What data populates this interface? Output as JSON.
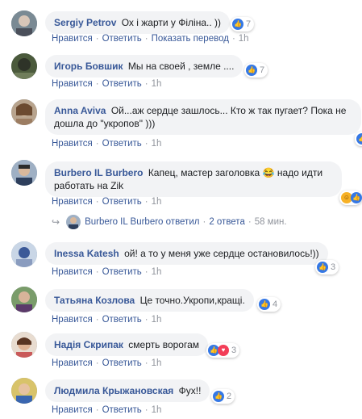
{
  "comments": [
    {
      "author": "Sergiy Petrov",
      "text": "Ох і жарти у Філіна.. ))",
      "reactions": "7",
      "like": "Нравится",
      "reply": "Ответить",
      "translate": "Показать перевод",
      "time": "1h"
    },
    {
      "author": "Игорь Бовшик",
      "text": "Мы на своей , земле ....",
      "reactions": "7",
      "like": "Нравится",
      "reply": "Ответить",
      "time": "1h"
    },
    {
      "author": "Anna Aviva",
      "text": "Ой...аж сердце зашлось... Кто ж так пугает? Пока не дошла до \"укропов\" )))",
      "reactions": "",
      "like": "Нравится",
      "reply": "Ответить",
      "time": "1h"
    },
    {
      "author": "Burbero IL Burbero",
      "text": "Капец, мастер заголовка 😂 надо идти работать на Zik",
      "reactions": "",
      "like": "Нравится",
      "reply": "Ответить",
      "time": "1h"
    },
    {
      "author": "Inessa Katesh",
      "text": "ой! а то у меня уже сердце остановилось!))",
      "reactions": "3",
      "like": "Нравится",
      "reply": "Ответить",
      "time": "1h"
    },
    {
      "author": "Татьяна Козлова",
      "text": "Це точно.Укропи,кращі.",
      "reactions": "4",
      "like": "Нравится",
      "reply": "Ответить",
      "time": "1h"
    },
    {
      "author": "Надія Скрипак",
      "text": "смерть ворогам",
      "reactions": "3",
      "like": "Нравится",
      "reply": "Ответить",
      "time": "1h"
    },
    {
      "author": "Людмила Крыжановская",
      "text": "Фух!!",
      "reactions": "2",
      "like": "Нравится",
      "reply": "Ответить",
      "time": "1h"
    }
  ],
  "reply_summary": {
    "author": "Burbero IL Burbero",
    "action": "ответил",
    "count": "2 ответа",
    "time": "58 мин."
  },
  "colors": {
    "link": "#385898",
    "bubble": "#f2f3f5",
    "meta": "#90949c",
    "like": "#3578e5"
  },
  "icons": [
    "like-icon",
    "haha-icon",
    "love-icon",
    "reply-arrow-icon"
  ]
}
